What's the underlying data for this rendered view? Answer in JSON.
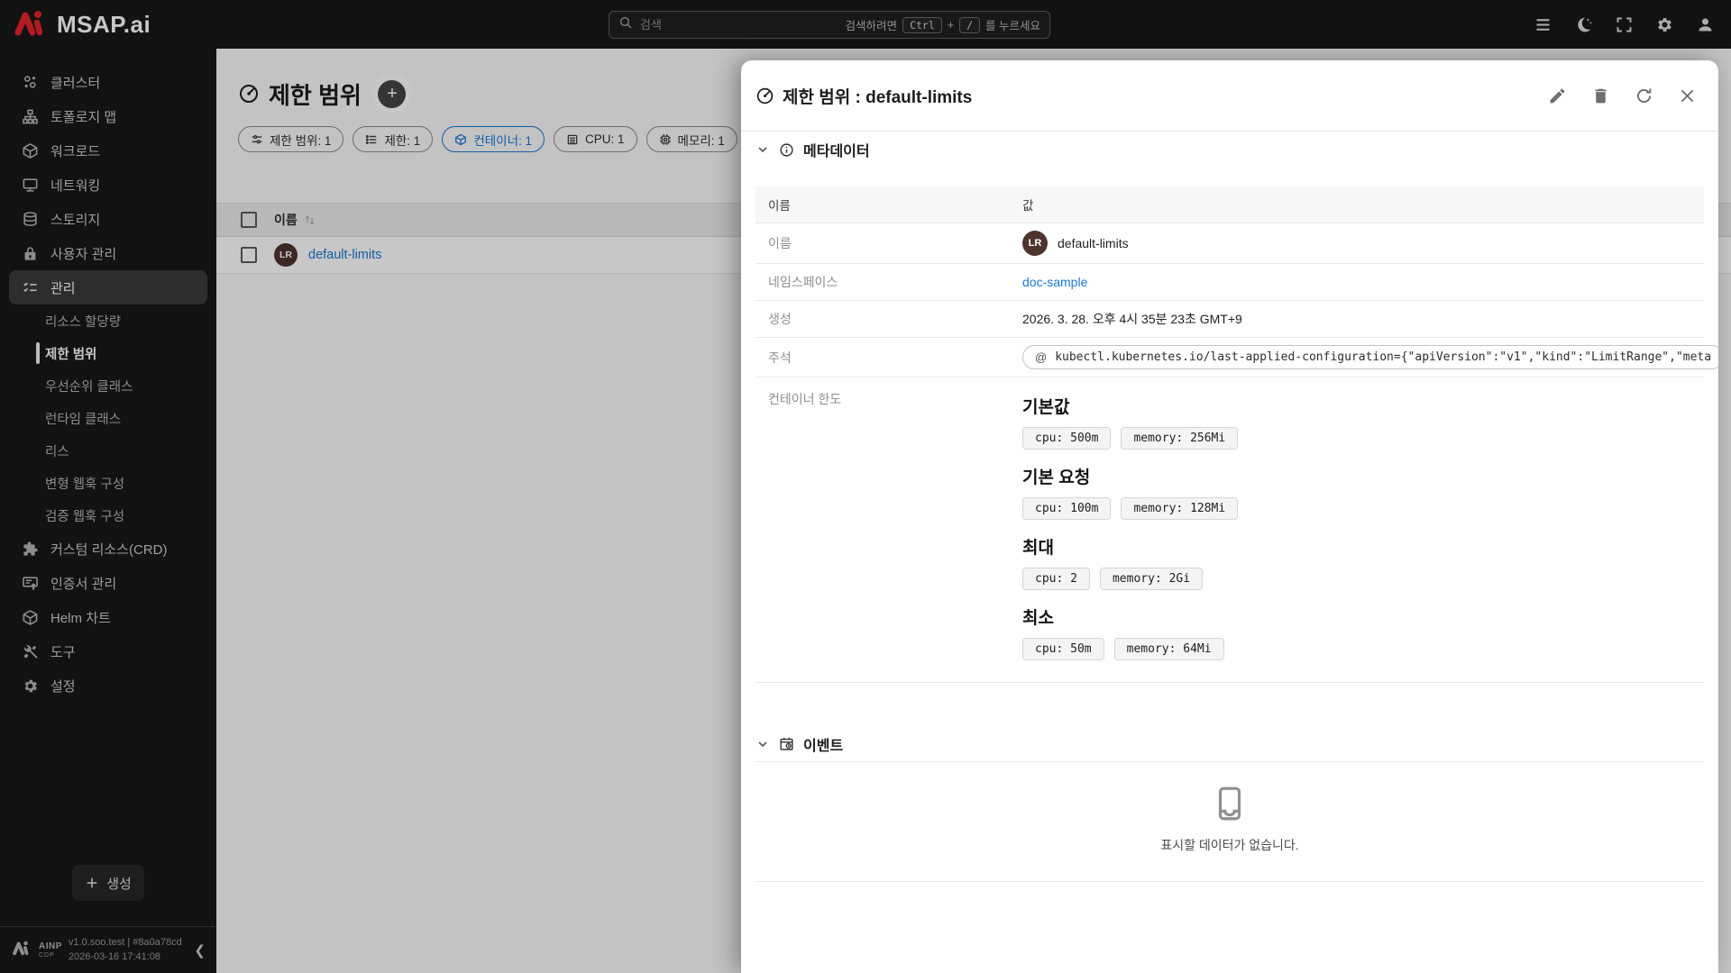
{
  "header": {
    "logo_text": "MSAP.ai",
    "search": {
      "placeholder": "검색",
      "hint_prefix": "검색하려면",
      "key_ctrl": "Ctrl",
      "key_plus": "+",
      "key_slash": "/",
      "hint_suffix": "를 누르세요"
    }
  },
  "sidebar": {
    "items": [
      {
        "label": "클러스터"
      },
      {
        "label": "토폴로지 맵"
      },
      {
        "label": "워크로드"
      },
      {
        "label": "네트워킹"
      },
      {
        "label": "스토리지"
      },
      {
        "label": "사용자 관리"
      },
      {
        "label": "관리"
      },
      {
        "label": "커스텀 리소스(CRD)"
      },
      {
        "label": "인증서 관리"
      },
      {
        "label": "Helm 차트"
      },
      {
        "label": "도구"
      },
      {
        "label": "설정"
      }
    ],
    "sub_items": [
      "리소스 할당량",
      "제한 범위",
      "우선순위 클래스",
      "런타임 클래스",
      "리스",
      "변형 웹훅 구성",
      "검증 웹훅 구성"
    ],
    "create_label": "생성",
    "footer": {
      "brand_top": "AINP",
      "brand_bottom": "CDP",
      "version": "v1.0.soo.test | #8a0a78cd",
      "timestamp": "2026-03-16 17:41:08"
    }
  },
  "main": {
    "title": "제한 범위",
    "chips": [
      {
        "label": "제한 범위: 1"
      },
      {
        "label": "제한: 1"
      },
      {
        "label": "컨테이너: 1"
      },
      {
        "label": "CPU: 1"
      },
      {
        "label": "메모리: 1"
      }
    ],
    "table": {
      "name_header": "이름",
      "row": {
        "badge": "LR",
        "name": "default-limits"
      }
    }
  },
  "drawer": {
    "title": "제한 범위 : default-limits",
    "metadata": {
      "section_title": "메타데이터",
      "col_name": "이름",
      "col_value": "값",
      "name_label": "이름",
      "name_badge": "LR",
      "name_value": "default-limits",
      "namespace_label": "네임스페이스",
      "namespace_value": "doc-sample",
      "created_label": "생성",
      "created_value": "2026. 3. 28. 오후 4시 35분 23초 GMT+9",
      "annotation_label": "주석",
      "annotation_at": "@",
      "annotation_value": "kubectl.kubernetes.io/last-applied-configuration={\"apiVersion\":\"v1\",\"kind\":\"LimitRange\",\"meta",
      "limits_label": "컨테이너 한도",
      "limit_groups": [
        {
          "title": "기본값",
          "chips": [
            "cpu: 500m",
            "memory: 256Mi"
          ]
        },
        {
          "title": "기본 요청",
          "chips": [
            "cpu: 100m",
            "memory: 128Mi"
          ]
        },
        {
          "title": "최대",
          "chips": [
            "cpu: 2",
            "memory: 2Gi"
          ]
        },
        {
          "title": "최소",
          "chips": [
            "cpu: 50m",
            "memory: 64Mi"
          ]
        }
      ]
    },
    "events": {
      "section_title": "이벤트",
      "empty_text": "표시할 데이터가 없습니다."
    }
  },
  "colors": {
    "accent_blue": "#1976d2",
    "logo_red": "#e3242b",
    "avatar_brown": "#4e342e",
    "topbar_bg": "#181818"
  }
}
